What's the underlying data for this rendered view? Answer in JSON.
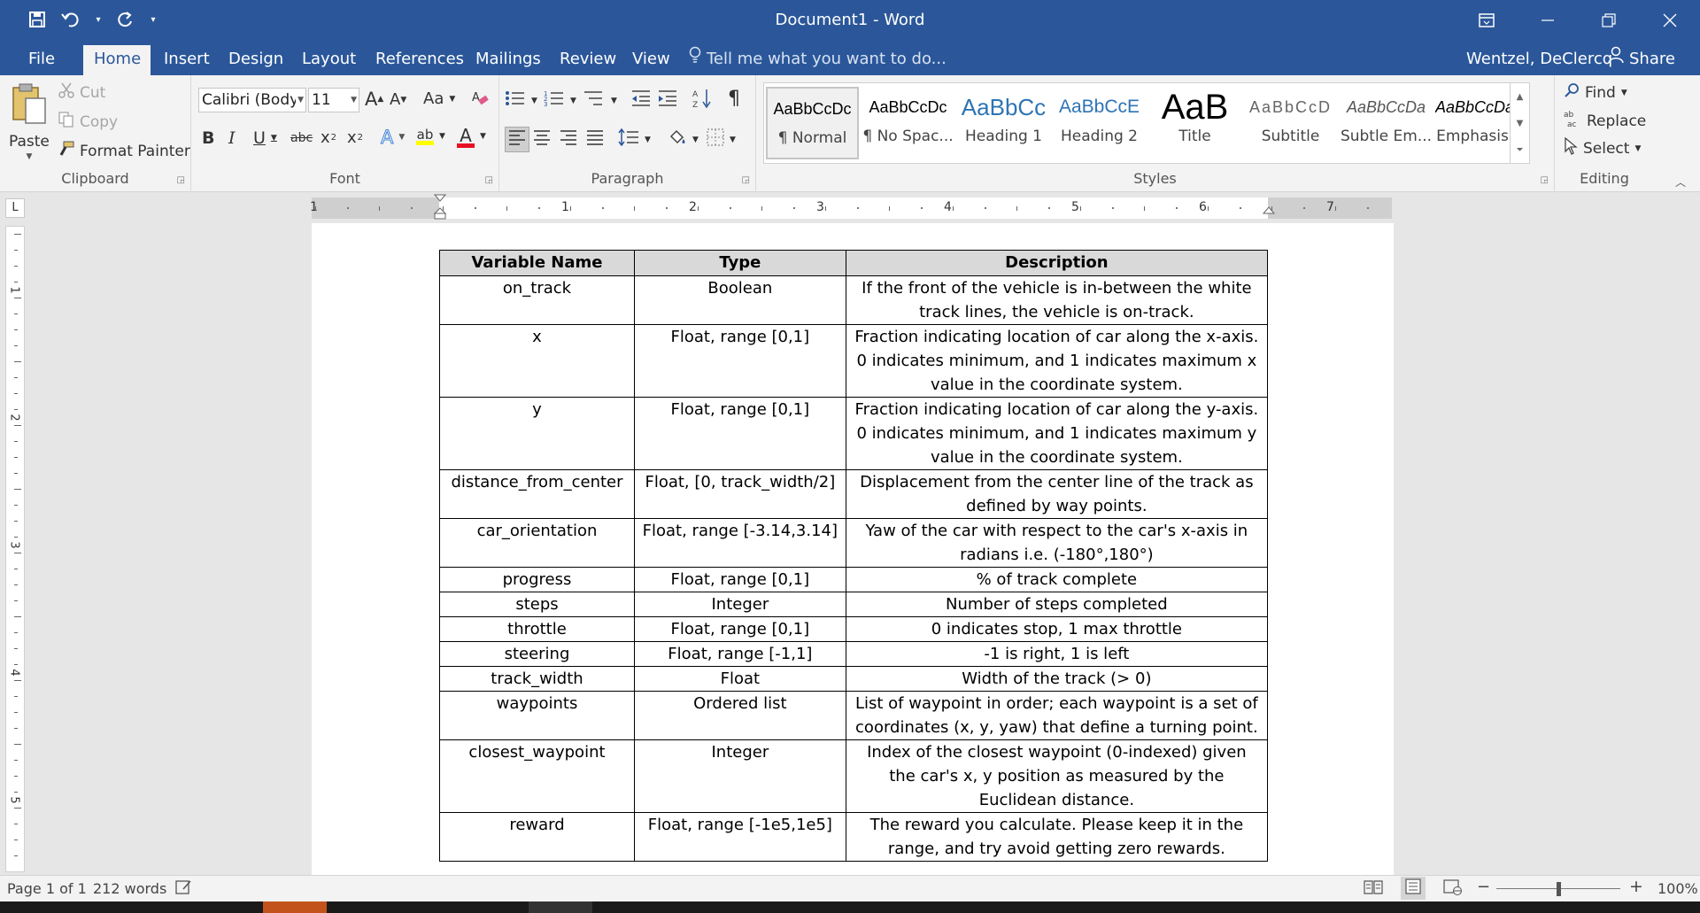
{
  "window": {
    "title": "Document1 - Word",
    "controls": {
      "restore_ribbon": "⧉",
      "minimize": "—",
      "maximize": "❐",
      "close": "✕"
    }
  },
  "quick_access": {
    "save": "💾",
    "undo": "↶",
    "undo_dropdown": "▾",
    "redo": "↻",
    "customize": "▾"
  },
  "tabs": [
    "File",
    "Home",
    "Insert",
    "Design",
    "Layout",
    "References",
    "Mailings",
    "Review",
    "View"
  ],
  "active_tab": "Home",
  "tell_me": "Tell me what you want to do...",
  "user": "Wentzel, DeClercq",
  "share_label": "Share",
  "ribbon": {
    "clipboard": {
      "paste": "Paste",
      "cut": "Cut",
      "copy": "Copy",
      "format_painter": "Format Painter",
      "group_label": "Clipboard"
    },
    "font": {
      "font_name": "Calibri (Body)",
      "font_size": "11",
      "grow": "A",
      "shrink": "A",
      "case": "Aa",
      "bold": "B",
      "italic": "I",
      "underline": "U",
      "strikethrough": "abc",
      "subscript": "x",
      "superscript": "x",
      "text_effects": "A",
      "highlight": "ab",
      "font_color": "A",
      "group_label": "Font",
      "font_color_hex": "#e81123",
      "highlight_hex": "#ffff00"
    },
    "paragraph": {
      "group_label": "Paragraph",
      "show_marks": "¶"
    },
    "styles": {
      "group_label": "Styles",
      "items": [
        {
          "preview": "AaBbCcDc",
          "name": "¶ Normal"
        },
        {
          "preview": "AaBbCcDc",
          "name": "¶ No Spac..."
        },
        {
          "preview": "AaBbCc",
          "name": "Heading 1"
        },
        {
          "preview": "AaBbCcE",
          "name": "Heading 2"
        },
        {
          "preview": "AaB",
          "name": "Title"
        },
        {
          "preview": "AaBbCcD",
          "name": "Subtitle"
        },
        {
          "preview": "AaBbCcDa",
          "name": "Subtle Em..."
        },
        {
          "preview": "AaBbCcDa",
          "name": "Emphasis"
        }
      ],
      "heading_color": "#2e74b5"
    },
    "editing": {
      "find": "Find",
      "replace": "Replace",
      "select": "Select",
      "group_label": "Editing"
    }
  },
  "ruler": {
    "numbers": [
      "1",
      "1",
      "2",
      "3",
      "4",
      "5",
      "6",
      "7"
    ],
    "vnumbers": [
      "1",
      "2",
      "3",
      "4",
      "5"
    ]
  },
  "table": {
    "headers": [
      "Variable Name",
      "Type",
      "Description"
    ],
    "rows": [
      [
        "on_track",
        "Boolean",
        "If the front of the vehicle is in-between the white track lines, the vehicle is on-track."
      ],
      [
        "x",
        "Float, range [0,1]",
        "Fraction indicating location of car along the x-axis. 0 indicates minimum, and 1 indicates maximum x value in the coordinate system."
      ],
      [
        "y",
        "Float, range [0,1]",
        "Fraction indicating location of car along the y-axis. 0 indicates minimum, and 1 indicates maximum y value in the coordinate system."
      ],
      [
        "distance_from_center",
        "Float, [0, track_width/2]",
        "Displacement from the center line of the track as defined by way points."
      ],
      [
        "car_orientation",
        "Float, range [-3.14,3.14]",
        "Yaw of the car with respect to the car's x-axis in radians i.e. (-180°,180°)"
      ],
      [
        "progress",
        "Float, range [0,1]",
        "% of track complete"
      ],
      [
        "steps",
        "Integer",
        "Number of steps completed"
      ],
      [
        "throttle",
        "Float, range [0,1]",
        "0 indicates stop, 1 max throttle"
      ],
      [
        "steering",
        "Float, range [-1,1]",
        "-1 is right, 1 is left"
      ],
      [
        "track_width",
        "Float",
        "Width of the track (> 0)"
      ],
      [
        "waypoints",
        "Ordered list",
        "List of waypoint in order; each waypoint is a set of coordinates (x, y, yaw) that define a turning point."
      ],
      [
        "closest_waypoint",
        "Integer",
        "Index of the closest waypoint (0-indexed) given the car's x, y position as measured by the Euclidean distance."
      ],
      [
        "reward",
        "Float, range [-1e5,1e5]",
        "The reward you calculate. Please keep it in the range, and try avoid getting zero rewards."
      ]
    ]
  },
  "status": {
    "page": "Page 1 of 1",
    "words": "212 words",
    "zoom": "100%",
    "zoom_minus": "−",
    "zoom_plus": "+"
  },
  "colors": {
    "brand": "#2b579a",
    "ribbon_bg": "#f3f3f3"
  }
}
